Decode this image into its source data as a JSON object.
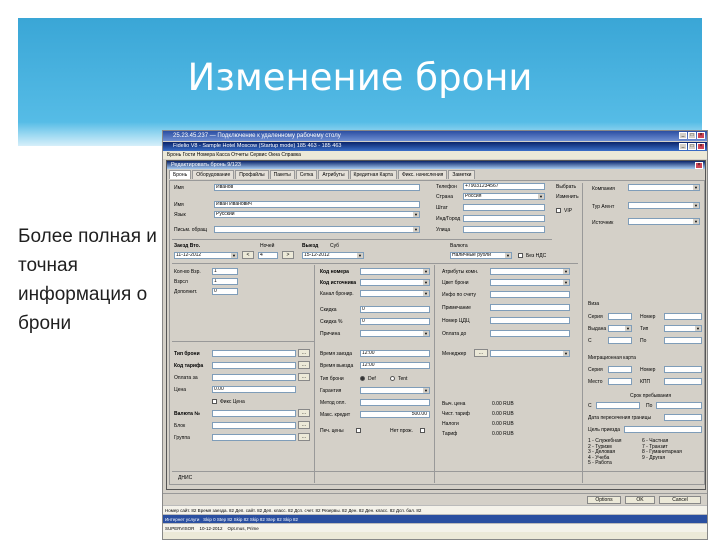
{
  "slide": {
    "title": "Изменение брони",
    "description": "Более полная и точная информация о брони"
  },
  "screen": {
    "rd_title": "25.23.45.237 — Подключение к удаленному рабочему столу",
    "app_title": "Fidelio V8 - Sample Hotel Moscow (Startup mode) 185 463 - 185 463",
    "menu": "Бронь  Гости  Номера  Касса  Отчеты  Сервис  Окна  Справка",
    "dialog_title": "Редактировать бронь 9/123",
    "tabs": [
      "Бронь",
      "Оборудование",
      "Профайлы",
      "Пакеты",
      "Сетка",
      "Атрибуты",
      "Кредитная Карта",
      "Фикс. начисления",
      "Заметки"
    ],
    "guest": {
      "labels": {
        "first_name": "Имя",
        "last_name": "Имя",
        "language": "Язык",
        "salutation": "Письм. обращ",
        "phone": "Телефон",
        "country": "Страна",
        "state": "Штат",
        "zip": "Инд/Город",
        "street": "Улица",
        "choose": "Выбрать",
        "change": "Изменить",
        "company": "Компания",
        "agent": "Тур Агент",
        "source": "Источник",
        "vip": "VIP"
      },
      "values": {
        "first_name": "Иванов",
        "last_name": "Иван Иванович",
        "language": "Русский",
        "phone": "+79031234567",
        "country": "Россия"
      }
    },
    "stay": {
      "labels": {
        "arrival": "Заезд Вто.",
        "nights": "Ночей",
        "departure": "Выезд",
        "departure_day": "Суб",
        "adults": "Кол-во Взр.",
        "children": "Взрсл",
        "extra": "Дополнит.",
        "room_type": "Код номера",
        "block": "Код источника",
        "channel": "Канал бронир.",
        "discount": "Скидка",
        "discount_pct": "Скидка %",
        "reason": "Причина",
        "rate_code": "Тип брони",
        "rate_type": "Код тарифа",
        "pay_to": "Оплата за",
        "price": "Цена",
        "fixed_price": "Фикс Цена",
        "currency_label": "Валюта №",
        "block2": "Блок",
        "group": "Группа",
        "arrival_time": "Время заезда",
        "departure_time": "Время выезда",
        "res_type": "Тип брони",
        "def": "Def",
        "tent": "Tent",
        "guarantee": "Гарантия",
        "pay_method": "Метод опл.",
        "max_credit": "Макс. кредит",
        "fix_rate": "Печ. цены",
        "no_post": "Нет прож.",
        "currency": "Валюта",
        "no_vat": "Без НДС",
        "attr_room": "Атрибуты комн.",
        "room_color": "Цвет брони",
        "room_info": "Инфо по счету",
        "note": "Примечание",
        "city_tax": "Номер ЦДЦ",
        "pay_before": "Оплата до",
        "manager": "Менеджер",
        "calc_price": "Выч. цена",
        "net_rate": "Чист. тариф",
        "taxes": "Налоги",
        "tariff": "Тариф",
        "visa": "Виза",
        "series": "Серия",
        "number": "Номер",
        "issued": "Выдана",
        "type": "Тип",
        "from": "С",
        "to": "По",
        "migration": "Миграционная карта",
        "series2": "Серия",
        "number2": "Номер",
        "place": "Место",
        "kpp": "КПП",
        "period": "Срок пребывания",
        "border_date": "Дата пересечения границы",
        "purpose": "Цель приезда",
        "purpose_list_a": "1 - Служебная\n2 - Туризм\n3 - Деловая\n4 - Учеба\n5 - Работа",
        "purpose_list_b": "6 - Частная\n7 - Транзит\n8 - Гуманитарная\n9 - Другая",
        "dnis": "ДНИС"
      },
      "values": {
        "arrival_date": "11-12-2012",
        "nights": "4",
        "departure_date": "15-12-2012",
        "adults": "1",
        "children": "1",
        "extra": "0",
        "discount": "0",
        "discount_pct": "0",
        "price": "0.00",
        "arrival_time": "12:00",
        "departure_time": "12:00",
        "max_credit": "500.00",
        "currency": "Наличные рубли",
        "calc_price": "0.00 RUB",
        "net_rate": "0.00 RUB",
        "taxes": "0.00 RUB",
        "tariff": "0.00 RUB"
      }
    },
    "footer": {
      "options": "Options",
      "ok": "OK",
      "cancel": "Cancel",
      "strip1": "Номер сайт. 82  Время заезда. 82  Деп. сайт. 82  Деп. класс. 82  Дсп. счет. 82  Резервы. 82  Ден. 82  Ден. класс. 82  Дсп. бал. 82",
      "strip2_label": "Интернет услуги",
      "strip2": "Skip 0  Step 82  Skip 82  Skip 82  Step 82  Skip 82",
      "strip3_label": "SUPERVISOR",
      "strip3_date": "10-12-2012",
      "strip3_mode": "Opt.mus, Prime"
    }
  }
}
